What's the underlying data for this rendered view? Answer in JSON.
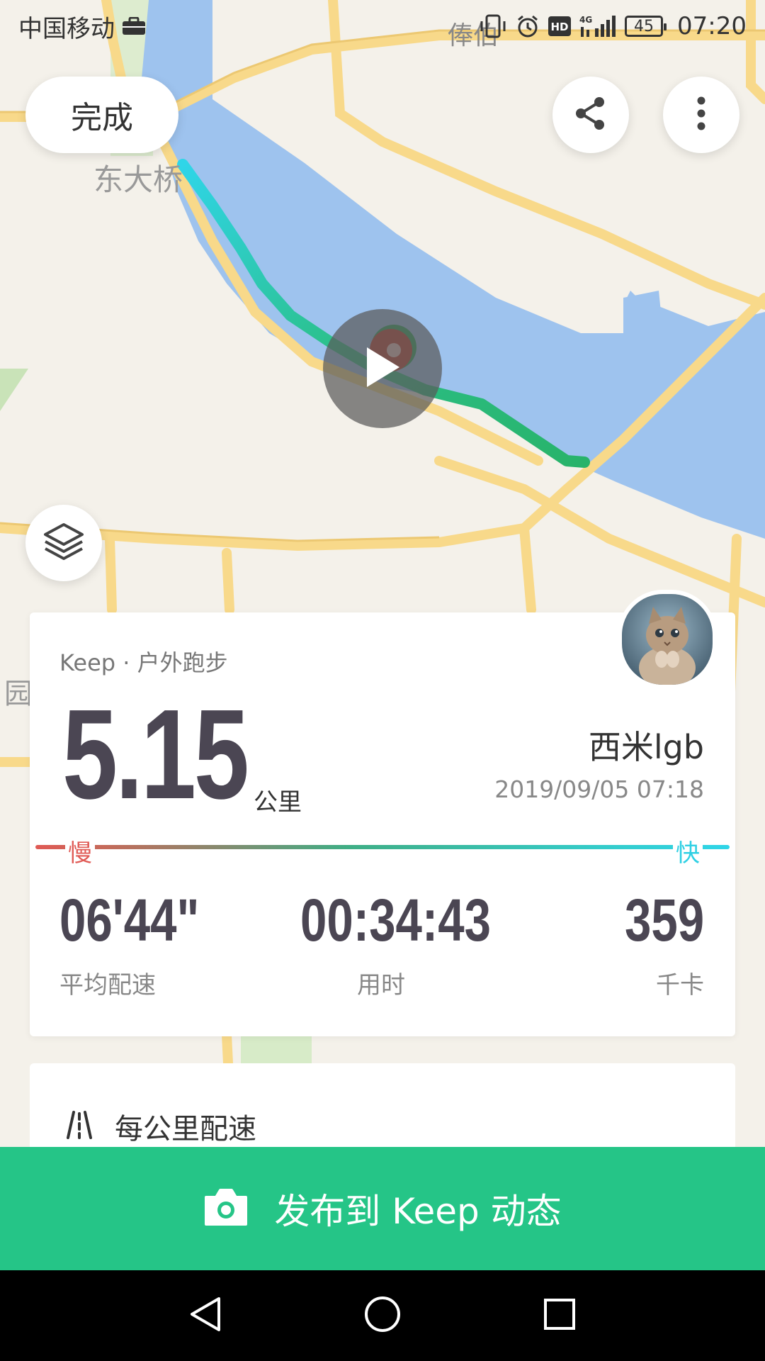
{
  "status_bar": {
    "carrier": "中国移动",
    "battery_level": "45",
    "time": "07:20",
    "icons": [
      "briefcase-icon",
      "vibrate-icon",
      "alarm-icon",
      "hd-icon",
      "4g-signal-icon",
      "battery-icon"
    ]
  },
  "map": {
    "labels": {
      "place_top": "俸伯",
      "place_left": "东大桥",
      "place_edge": "园"
    },
    "colors": {
      "water": "#9ec3ee",
      "road": "#f8d98a",
      "land": "#f4f1ea",
      "route_start": "#2fd5e8",
      "route_end": "#28b36a"
    }
  },
  "toolbar": {
    "done_label": "完成",
    "share_icon": "share-icon",
    "more_icon": "more-vertical-icon",
    "layers_icon": "layers-icon",
    "play_icon": "play-icon"
  },
  "summary": {
    "source": "Keep · 户外跑步",
    "distance": "5.15",
    "distance_unit": "公里",
    "user_name": "西米lgb",
    "datetime": "2019/09/05 07:18",
    "pace_slow_label": "慢",
    "pace_fast_label": "快",
    "stats": [
      {
        "value": "06'44\"",
        "label": "平均配速"
      },
      {
        "value": "00:34:43",
        "label": "用时"
      },
      {
        "value": "359",
        "label": "千卡"
      }
    ]
  },
  "splits": {
    "title": "每公里配速"
  },
  "publish": {
    "label": "发布到 Keep 动态",
    "icon": "camera-icon",
    "color": "#25c587"
  },
  "nav": {
    "back_icon": "back-triangle-icon",
    "home_icon": "home-circle-icon",
    "recents_icon": "recents-square-icon"
  }
}
